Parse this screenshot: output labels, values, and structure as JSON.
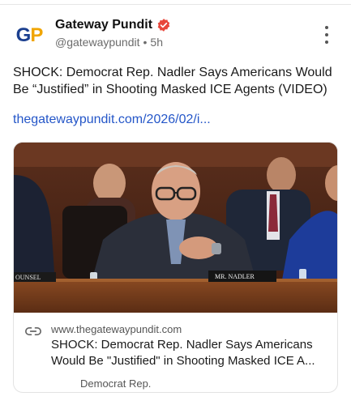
{
  "author": {
    "avatar_text_g": "G",
    "avatar_text_p": "P",
    "name": "Gateway Pundit",
    "handle": "@gatewaypundit",
    "time": "5h",
    "verified_color": "#e8463a"
  },
  "post": {
    "text": "SHOCK: Democrat Rep. Nadler Says Americans Would Be “Justified” in Shooting Masked ICE Agents (VIDEO)",
    "link_text": "thegatewaypundit.com/2026/02/i..."
  },
  "card": {
    "image_nameplate": "MR. NADLER",
    "image_left_plate": "OUNSEL",
    "domain": "www.thegatewaypundit.com",
    "title": "SHOCK: Democrat Rep. Nadler Says Americans Would Be \"Justified\" in Shooting Masked ICE A...",
    "subtitle": "Democrat Rep."
  },
  "colors": {
    "link": "#2456c8",
    "brand_blue": "#1b3f8f",
    "brand_gold": "#f0a500"
  }
}
